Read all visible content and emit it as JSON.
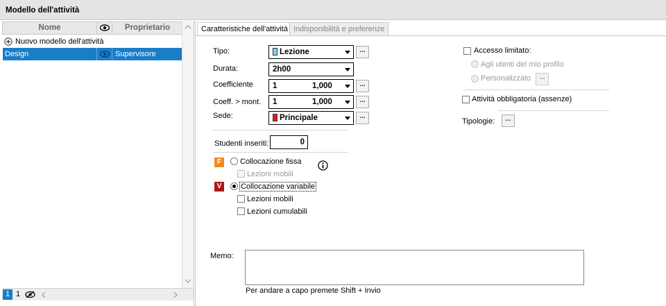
{
  "window": {
    "title": "Modello dell'attività"
  },
  "left": {
    "columns": {
      "name": "Nome",
      "owner": "Proprietario"
    },
    "new_item_label": "Nuovo modello dell'attività",
    "rows": [
      {
        "name": "Design",
        "owner": "Supervisore"
      }
    ],
    "status": {
      "page": "1",
      "count": "1"
    }
  },
  "tabs": [
    {
      "label": "Caratteristiche dell'attività",
      "active": true
    },
    {
      "label": "Indisponibilità e preferenze",
      "active": false
    }
  ],
  "form": {
    "tipo": {
      "label": "Tipo:",
      "value": "Lezione",
      "color": "#7fd6e8"
    },
    "durata": {
      "label": "Durata:",
      "value": "2h00"
    },
    "coefficiente": {
      "label": "Coefficiente",
      "value": "1",
      "factor": "1,000"
    },
    "coeff_mont": {
      "label": "Coeff. > mont.",
      "value": "1",
      "factor": "1,000"
    },
    "sede": {
      "label": "Sede:",
      "value": "Principale",
      "color": "#e02020"
    },
    "studenti": {
      "label": "Studenti inseriti:",
      "value": "0"
    },
    "collocazione_fissa": {
      "badge": "F",
      "badge_color": "#f08a1c",
      "label": "Collocazione fissa",
      "lezioni_mobili": "Lezioni mobili"
    },
    "collocazione_variabile": {
      "badge": "V",
      "badge_color": "#b01818",
      "label": "Collocazione variabile",
      "lezioni_mobili": "Lezioni mobili",
      "lezioni_cumulabili": "Lezioni cumulabili"
    },
    "accesso": {
      "label": "Accesso limitato:",
      "option1": "Agli utenti del mio profilo",
      "option2": "Personalizzato"
    },
    "obbligatoria": {
      "label": "Attività obbligatoria (assenze)"
    },
    "tipologie": {
      "label": "Tipologie:"
    },
    "memo": {
      "label": "Memo:",
      "hint": "Per andare a capo premete Shift + Invio"
    },
    "dots_label": "..."
  }
}
